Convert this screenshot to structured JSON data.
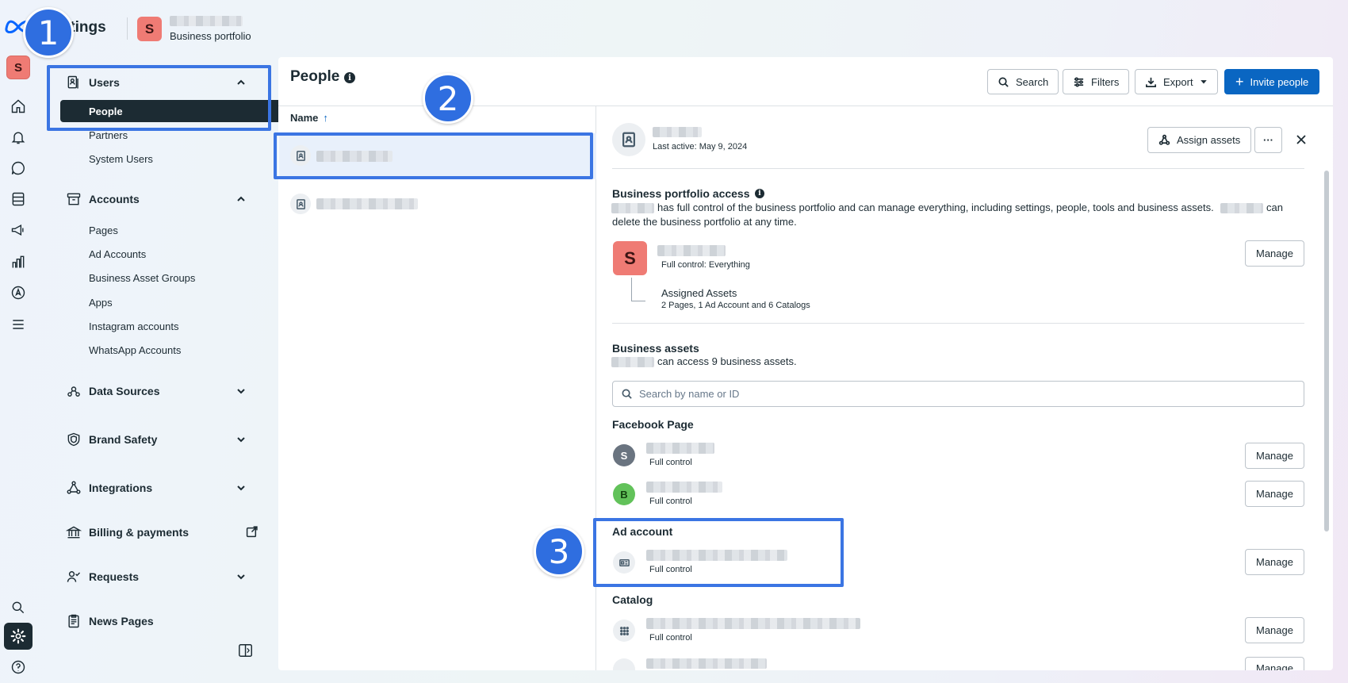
{
  "header": {
    "app_title": "Settings",
    "app_title_visible": "ttings",
    "portfolio_initial": "S",
    "portfolio_subtitle": "Business portfolio"
  },
  "rail": {
    "avatar_initial": "S",
    "icons": [
      "home-icon",
      "bell-icon",
      "chat-icon",
      "pages-icon",
      "megaphone-icon",
      "chart-icon",
      "compass-icon",
      "menu-icon",
      "search-icon",
      "gear-icon",
      "help-icon"
    ]
  },
  "sidebar": {
    "sections": [
      {
        "label": "Users",
        "expanded": true,
        "items": [
          "People",
          "Partners",
          "System Users"
        ],
        "active": "People"
      },
      {
        "label": "Accounts",
        "expanded": true,
        "items": [
          "Pages",
          "Ad Accounts",
          "Business Asset Groups",
          "Apps",
          "Instagram accounts",
          "WhatsApp Accounts"
        ]
      },
      {
        "label": "Data Sources",
        "expanded": false
      },
      {
        "label": "Brand Safety",
        "expanded": false
      },
      {
        "label": "Integrations",
        "expanded": false
      },
      {
        "label": "Billing & payments",
        "external": true
      },
      {
        "label": "Requests",
        "expanded": false
      },
      {
        "label": "News Pages"
      }
    ]
  },
  "people": {
    "title": "People",
    "column_name": "Name",
    "sort_arrow": "↑"
  },
  "toolbar": {
    "search_label": "Search",
    "filters_label": "Filters",
    "export_label": "Export",
    "invite_label": "Invite people"
  },
  "detail": {
    "last_active": "Last active: May 9, 2024",
    "assign_label": "Assign assets",
    "more_label": "···",
    "portfolio_access": {
      "title": "Business portfolio access",
      "description_a": "has full control of the business portfolio and can manage everything, including settings, people, tools and business assets.",
      "description_b": "can",
      "description_c": "delete the business portfolio at any time.",
      "avatar_initial": "S",
      "access_level": "Full control: Everything",
      "assigned_title": "Assigned Assets",
      "assigned_summary": "2 Pages, 1 Ad Account and 6 Catalogs",
      "manage_label": "Manage"
    },
    "business_assets": {
      "title": "Business assets",
      "summary": "can access 9 business assets.",
      "search_placeholder": "Search by name or ID"
    },
    "facebook_page": {
      "title": "Facebook Page",
      "items": [
        {
          "initial": "S",
          "access": "Full control",
          "manage": "Manage",
          "color": "#6a7480"
        },
        {
          "initial": "B",
          "access": "Full control",
          "manage": "Manage",
          "color": "#62c25a"
        }
      ]
    },
    "ad_account": {
      "title": "Ad account",
      "access": "Full control",
      "manage": "Manage"
    },
    "catalog": {
      "title": "Catalog",
      "access": "Full control",
      "manage": "Manage"
    }
  },
  "callouts": [
    "1",
    "2",
    "3"
  ],
  "colors": {
    "accent": "#0a66c2",
    "highlight": "#3b75e3",
    "nav_active": "#1c2b33",
    "portfolio_avatar": "#ef7b74"
  }
}
